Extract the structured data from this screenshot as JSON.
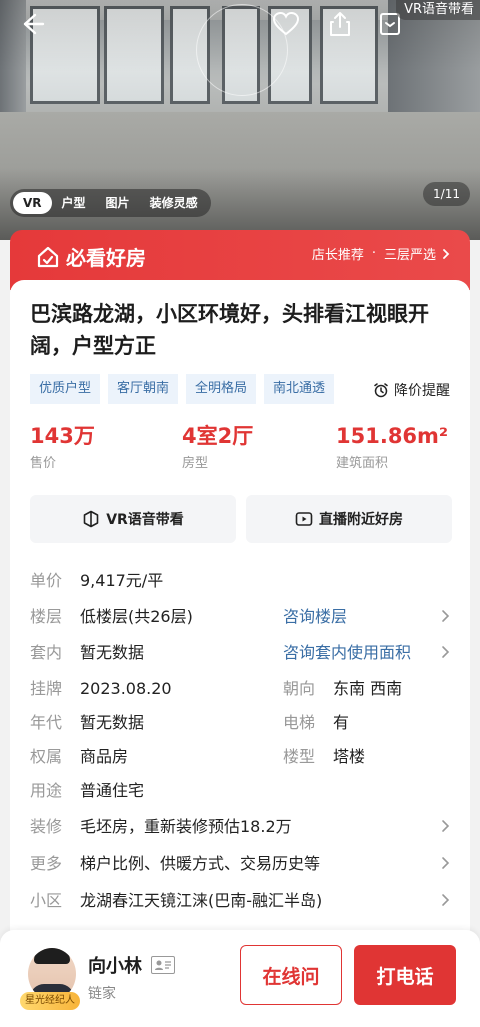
{
  "hero": {
    "vr_tag": "VR语音带看",
    "counter": "1/11",
    "tabs": [
      {
        "label": "VR",
        "active": true
      },
      {
        "label": "户型",
        "active": false
      },
      {
        "label": "图片",
        "active": false
      },
      {
        "label": "装修灵感",
        "active": false
      }
    ]
  },
  "banner": {
    "logo_text": "必看好房",
    "rec_left": "店长推荐",
    "rec_dot": "·",
    "rec_right": "三层严选"
  },
  "listing": {
    "title": "巴滨路龙湖，小区环境好，头排看江视眼开阔，户型方正",
    "tags": [
      "优质户型",
      "客厅朝南",
      "全明格局",
      "南北通透"
    ],
    "price_alert": "降价提醒",
    "stats": [
      {
        "value": "143万",
        "label": "售价"
      },
      {
        "value": "4室2厅",
        "label": "房型"
      },
      {
        "value": "151.86m²",
        "label": "建筑面积"
      }
    ],
    "actions": {
      "vr": "VR语音带看",
      "live": "直播附近好房"
    }
  },
  "details": {
    "unit_price": {
      "k": "单价",
      "v": "9,417元/平"
    },
    "floor": {
      "k": "楼层",
      "v": "低楼层(共26层)",
      "link": "咨询楼层"
    },
    "inner": {
      "k": "套内",
      "v": "暂无数据",
      "link": "咨询套内使用面积"
    },
    "listed": {
      "k": "挂牌",
      "v": "2023.08.20",
      "k2": "朝向",
      "v2": "东南 西南"
    },
    "year": {
      "k": "年代",
      "v": "暂无数据",
      "k2": "电梯",
      "v2": "有"
    },
    "ownership": {
      "k": "权属",
      "v": "商品房",
      "k2": "楼型",
      "v2": "塔楼"
    },
    "usage": {
      "k": "用途",
      "v": "普通住宅"
    },
    "decoration": {
      "k": "装修",
      "v": "毛坯房，重新装修预估18.2万"
    },
    "more": {
      "k": "更多",
      "v": "梯户比例、供暖方式、交易历史等"
    },
    "community": {
      "k": "小区",
      "v": "龙湖春江天镜江涞(巴南-融汇半岛)"
    }
  },
  "agent": {
    "name": "向小林",
    "company": "链家",
    "badge": "星光经纪人",
    "chat_label": "在线问",
    "call_label": "打电话"
  },
  "colors": {
    "accent": "#e03534",
    "link": "#3a6ea5",
    "tag_bg": "#ecf3fb"
  }
}
